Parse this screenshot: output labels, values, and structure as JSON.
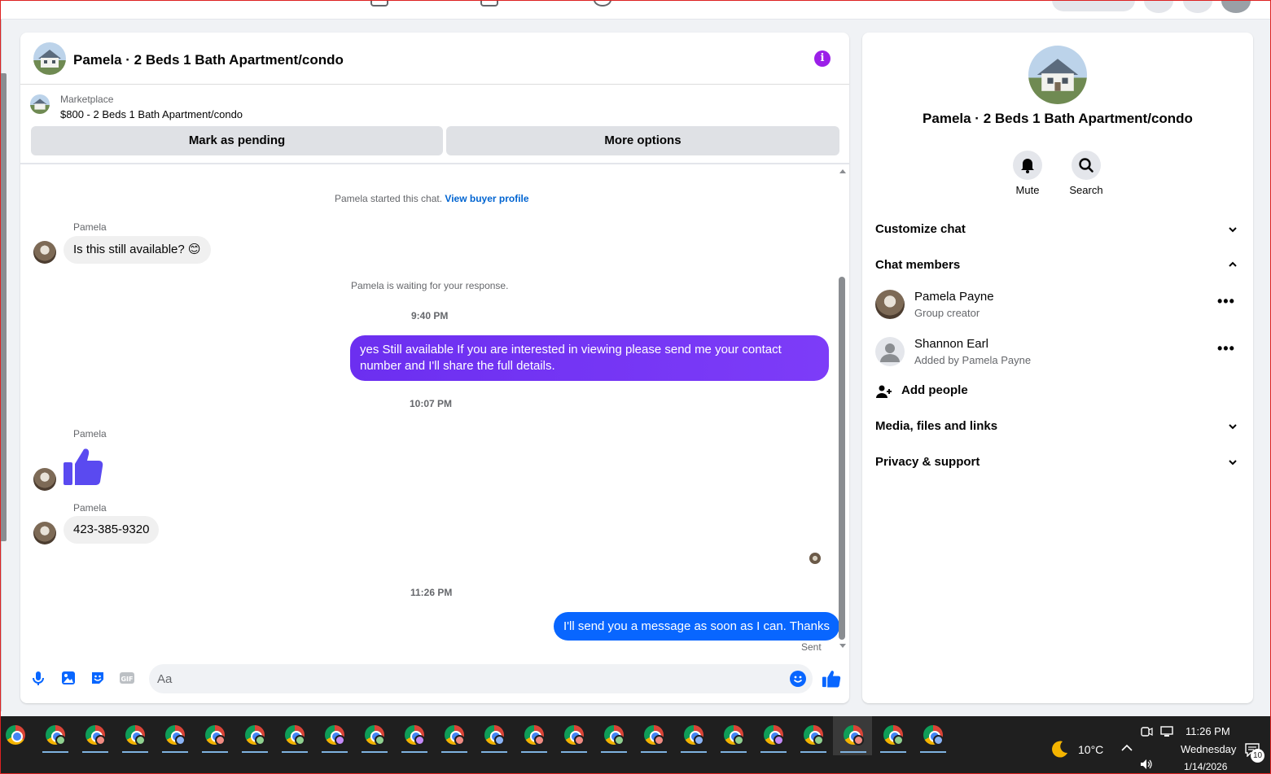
{
  "conversation": {
    "title": "Pamela · 2 Beds 1 Bath Apartment/condo",
    "marketplace_label": "Marketplace",
    "listing": "$800 - 2 Beds 1 Bath Apartment/condo",
    "mark_pending": "Mark as pending",
    "more_options": "More options"
  },
  "messages": {
    "started_text": "Pamela started this chat.",
    "view_buyer_profile": "View buyer profile",
    "sender": "Pamela",
    "msg1": "Is this still available? 😊",
    "waiting": "Pamela is waiting for your response.",
    "time1": "9:40 PM",
    "msg2": "yes Still available If you are interested in viewing please send me your contact number and I'll share the full details.",
    "time2": "10:07 PM",
    "msg4": "423-385-9320",
    "time3": "11:26 PM",
    "msg5": "I'll send you a message as soon as I can. Thanks",
    "sent_status": "Sent"
  },
  "composer": {
    "placeholder": "Aa"
  },
  "panel": {
    "title": "Pamela · 2 Beds 1 Bath Apartment/condo",
    "mute": "Mute",
    "search": "Search",
    "customize_chat": "Customize chat",
    "chat_members": "Chat members",
    "members": [
      {
        "name": "Pamela Payne",
        "sub": "Group creator"
      },
      {
        "name": "Shannon Earl",
        "sub": "Added by Pamela Payne"
      }
    ],
    "add_people": "Add people",
    "media": "Media, files and links",
    "privacy": "Privacy & support"
  },
  "taskbar": {
    "weather": "10°C",
    "time": "11:26 PM",
    "day": "Wednesday",
    "date": "1/14/2026",
    "notifications": "10"
  },
  "colors": {
    "outgoing_purple": "#7b2ff7",
    "outgoing_blue": "#0866ff",
    "accent": "#0866ff",
    "info": "#9b1fe8"
  }
}
